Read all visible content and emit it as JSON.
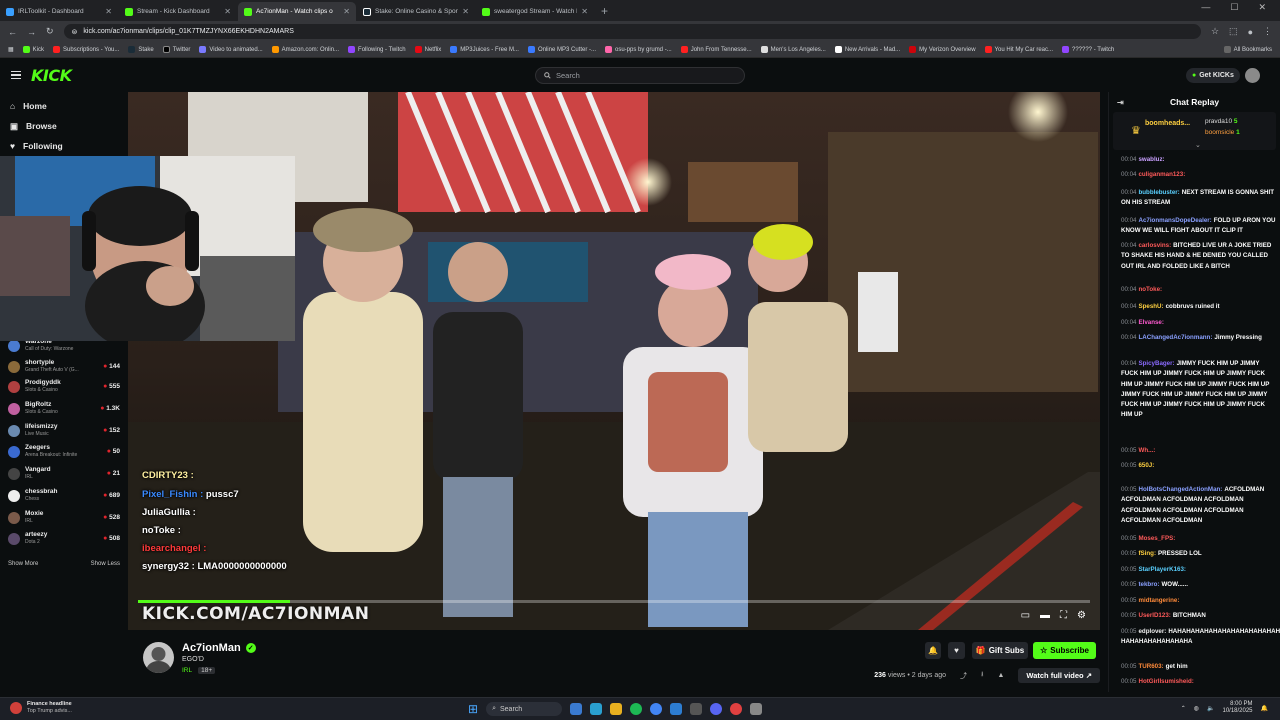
{
  "browser": {
    "tabs": [
      {
        "title": "IRLToolkit - Dashboard",
        "color": "#3aa0ff",
        "active": false
      },
      {
        "title": "Stream - Kick Dashboard",
        "color": "#53fc18",
        "active": false
      },
      {
        "title": "Ac7ionMan - Watch clips o",
        "color": "#53fc18",
        "active": true
      },
      {
        "title": "Stake: Online Casino & Sports",
        "color": "#1a2c38",
        "active": false
      },
      {
        "title": "sweatergod Stream - Watch Li",
        "color": "#53fc18",
        "active": false
      }
    ],
    "new_tab": "+",
    "url": "kick.com/ac7ionman/clips/clip_01K7TMZJYNX66EKHDHN2AMARS",
    "bookmarks": [
      "Kick",
      "Subscriptions - You...",
      "Stake",
      "Twitter",
      "Video to animated...",
      "Amazon.com: Onlin...",
      "Following - Twitch",
      "Netflix",
      "MP3Juices - Free M...",
      "Online MP3 Cutter -...",
      "osu-pps by grumd -...",
      "John From Tennesse...",
      "Men's Los Angeles...",
      "New Arrivals - Mad...",
      "My Verizon Overview",
      "You Hit My Car reac...",
      "?????? - Twitch",
      "All Bookmarks"
    ]
  },
  "header": {
    "logo": "KICK",
    "search_placeholder": "Search",
    "get_kicks": "Get KICKs"
  },
  "sidebar": {
    "nav": [
      {
        "label": "Home",
        "icon": "home-icon"
      },
      {
        "label": "Browse",
        "icon": "browse-icon"
      },
      {
        "label": "Following",
        "icon": "heart-icon"
      }
    ],
    "channels": [
      {
        "name": "Warzone",
        "game": "Call of Duty: Warzone",
        "viewers": "",
        "color": "#4a7bd0"
      },
      {
        "name": "shortyple",
        "game": "Grand Theft Auto V (G...",
        "viewers": "144",
        "color": "#8a6a3a"
      },
      {
        "name": "Prodigyddk",
        "game": "Slots & Casino",
        "viewers": "555",
        "color": "#b04040"
      },
      {
        "name": "BigRoltz",
        "game": "Slots & Casino",
        "viewers": "1.3K",
        "color": "#c060a0"
      },
      {
        "name": "lifeismizzy",
        "game": "Live Music",
        "viewers": "152",
        "color": "#6a8ab0"
      },
      {
        "name": "Zeegers",
        "game": "Arena Breakout: Infinite",
        "viewers": "50",
        "color": "#3a6ad0"
      },
      {
        "name": "Vangard",
        "game": "IRL",
        "viewers": "21",
        "color": "#444"
      },
      {
        "name": "chessbrah",
        "game": "Chess",
        "viewers": "689",
        "color": "#eee"
      },
      {
        "name": "Moxie",
        "game": "IRL",
        "viewers": "528",
        "color": "#7a5a4a"
      },
      {
        "name": "arteezy",
        "game": "Dota 2",
        "viewers": "508",
        "color": "#5a4a6a"
      }
    ],
    "show_more": "Show More",
    "show_less": "Show Less"
  },
  "video": {
    "overlay_chat": [
      {
        "user": "CDIRTY23 :",
        "text": "",
        "color": "#fff0a0"
      },
      {
        "user": "Pixel_Fishin :",
        "text": "pussc7",
        "color": "#3a8aff"
      },
      {
        "user": "JuliaGullia :",
        "text": "",
        "color": "#ffffff"
      },
      {
        "user": "noToke :",
        "text": "",
        "color": "#ffffff"
      },
      {
        "user": "ibearchangel :",
        "text": "",
        "color": "#ff3a3a"
      },
      {
        "user": "synergy32 :",
        "text": "LMA0000000000000",
        "color": "#ffffff"
      }
    ],
    "watermark": "KICK.COM/AC7IONMAN",
    "progress": 0.16
  },
  "channel": {
    "name": "Ac7ionMan",
    "title": "EGO'D",
    "category": "IRL",
    "rating": "18+",
    "gift_subs": "Gift Subs",
    "subscribe": "Subscribe",
    "views": "236",
    "views_label": "views",
    "age": "2 days ago",
    "watch_full": "Watch full video"
  },
  "chat": {
    "title": "Chat Replay",
    "leaderboard": [
      {
        "name": "boomheads...",
        "count": ""
      },
      {
        "name": "pravda10",
        "count": "5"
      },
      {
        "name": "boomsicle",
        "count": "1"
      }
    ],
    "messages": [
      {
        "time": "00:04",
        "user": "swabluz:",
        "text": "",
        "color": "#c9a0ff"
      },
      {
        "time": "00:04",
        "user": "culiganman123:",
        "text": "",
        "color": "#ff5a5a"
      },
      {
        "time": "00:04",
        "user": "bubblebuster:",
        "text": "NEXT STREAM IS GONNA SHIT ON HIS STREAM",
        "color": "#5ad0ff"
      },
      {
        "time": "00:04",
        "user": "Ac7ionmansDopeDealer:",
        "text": "FOLD UP ARON YOU KNOW WE WILL FIGHT ABOUT IT CLIP IT",
        "color": "#8aa0ff"
      },
      {
        "time": "00:04",
        "user": "carlosvins:",
        "text": "BITCHED LIVE UR A JOKE TRIED TO SHAKE HIS HAND & HE DENIED YOU CALLED OUT IRL AND FOLDED LIKE A BITCH",
        "color": "#ff5a5a"
      },
      {
        "time": "00:04",
        "user": "noToke:",
        "text": "",
        "color": "#ff5a5a"
      },
      {
        "time": "00:04",
        "user": "SpeshU:",
        "text": "cobbruvs ruined it",
        "color": "#ffd040"
      },
      {
        "time": "00:04",
        "user": "Elvanse:",
        "text": "",
        "color": "#ff5ad0"
      },
      {
        "time": "00:04",
        "user": "LAChangedAc7ionmann:",
        "text": "Jimmy Pressing",
        "color": "#8aa0ff"
      },
      {
        "time": "00:04",
        "user": "SpicyBager:",
        "text": "JIMMY FUCK HIM UP JIMMY FUCK HIM UP JIMMY FUCK HIM UP JIMMY FUCK HIM UP JIMMY FUCK HIM UP JIMMY FUCK HIM UP JIMMY FUCK HIM UP JIMMY FUCK HIM UP JIMMY FUCK HIM UP JIMMY FUCK HIM UP JIMMY FUCK HIM UP",
        "color": "#8a6aff"
      },
      {
        "time": "00:05",
        "user": "Wh...:",
        "text": "",
        "color": "#ff5a5a"
      },
      {
        "time": "00:05",
        "user": "650J:",
        "text": "",
        "color": "#ffd040"
      },
      {
        "time": "00:05",
        "user": "HolBotsChangedActionMan:",
        "text": "ACFOLDMAN ACFOLDMAN ACFOLDMAN ACFOLDMAN ACFOLDMAN ACFOLDMAN ACFOLDMAN ACFOLDMAN ACFOLDMAN",
        "color": "#8aa0ff"
      },
      {
        "time": "00:05",
        "user": "Moses_FPS:",
        "text": "",
        "color": "#ff5a5a"
      },
      {
        "time": "00:05",
        "user": "fSing:",
        "text": "PRESSED LOL",
        "color": "#ffd040"
      },
      {
        "time": "00:05",
        "user": "StarPlayerK163:",
        "text": "",
        "color": "#5ad0ff"
      },
      {
        "time": "00:05",
        "user": "tekbro:",
        "text": "WOW......",
        "color": "#8aa0ff"
      },
      {
        "time": "00:05",
        "user": "midtangerine:",
        "text": "",
        "color": "#ff8a3a"
      },
      {
        "time": "00:05",
        "user": "UserID123:",
        "text": "BITCHMAN",
        "color": "#ff5a5a"
      },
      {
        "time": "00:05",
        "user": "edplover:",
        "text": "HAHAHAHAHAHAHAHAHAHAHAHAHAHAHAHAHA HAHAHAHAHAHAHAHA",
        "color": "#eeeeee"
      },
      {
        "time": "00:05",
        "user": "TUR603:",
        "text": "get him",
        "color": "#ff8a3a"
      },
      {
        "time": "00:05",
        "user": "HotGirlIsumisheid:",
        "text": "",
        "color": "#ff5a5a"
      }
    ]
  },
  "taskbar": {
    "news_title": "Finance headline",
    "news_sub": "Top Trump advis...",
    "search": "Search",
    "time": "8:00 PM",
    "date": "10/18/2025"
  }
}
